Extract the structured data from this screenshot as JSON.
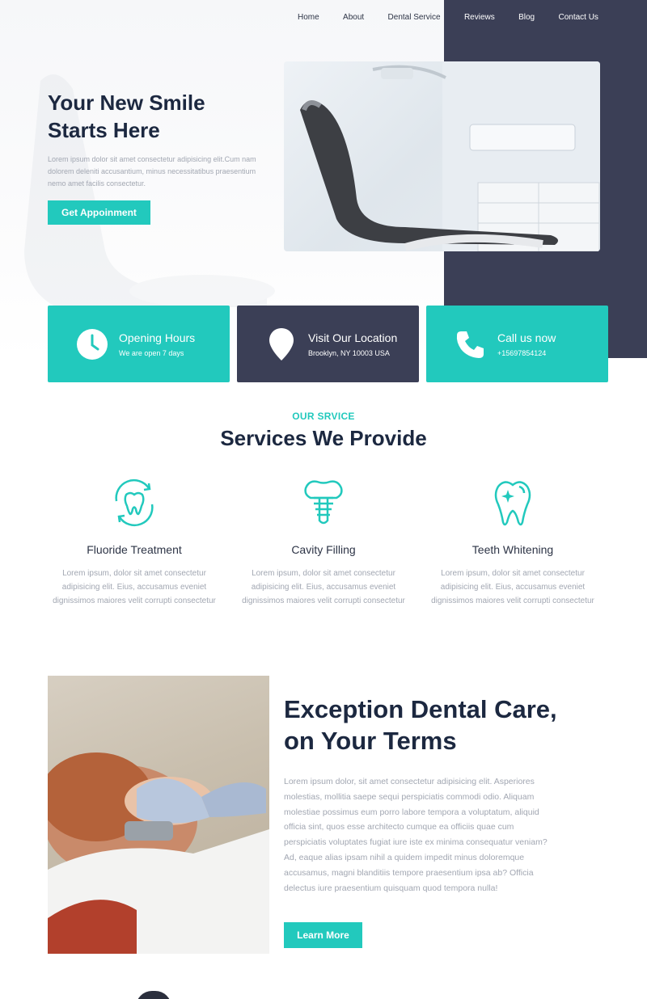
{
  "nav": {
    "items": [
      {
        "label": "Home"
      },
      {
        "label": "About"
      },
      {
        "label": "Dental Service"
      },
      {
        "label": "Reviews"
      },
      {
        "label": "Blog"
      },
      {
        "label": "Contact Us"
      }
    ]
  },
  "hero": {
    "title_line1": "Your New Smile",
    "title_line2": "Starts Here",
    "description": "Lorem ipsum dolor sit amet consectetur adipisicing elit.Cum nam dolorem deleniti accusantium, minus necessitatibus praesentium nemo amet facilis consectetur.",
    "button_label": "Get Appoinment"
  },
  "cards": [
    {
      "title": "Opening Hours",
      "subtitle": "We are open 7 days",
      "icon": "clock-icon"
    },
    {
      "title": "Visit Our Location",
      "subtitle": "Brooklyn, NY 10003 USA",
      "icon": "location-pin-icon"
    },
    {
      "title": "Call us now",
      "subtitle": "+15697854124",
      "icon": "phone-icon"
    }
  ],
  "services": {
    "kicker": "OUR SRVICE",
    "heading": "Services We Provide",
    "items": [
      {
        "title": "Fluoride Treatment",
        "description": "Lorem ipsum, dolor sit amet consectetur adipisicing elit. Eius, accusamus eveniet dignissimos maiores velit corrupti consectetur",
        "icon": "tooth-cycle-icon"
      },
      {
        "title": "Cavity Filling",
        "description": "Lorem ipsum, dolor sit amet consectetur adipisicing elit. Eius, accusamus eveniet dignissimos maiores velit corrupti consectetur",
        "icon": "dental-implant-icon"
      },
      {
        "title": "Teeth Whitening",
        "description": "Lorem ipsum, dolor sit amet consectetur adipisicing elit. Eius, accusamus eveniet dignissimos maiores velit corrupti consectetur",
        "icon": "tooth-sparkle-icon"
      }
    ]
  },
  "care": {
    "title_line1": "Exception Dental Care,",
    "title_line2": "on Your Terms",
    "text": "Lorem ipsum dolor, sit amet consectetur adipisicing elit. Asperiores molestias, mollitia saepe sequi perspiciatis commodi odio. Aliquam molestiae possimus eum porro labore tempora a voluptatum, aliquid officia sint, quos esse architecto cumque ea officiis quae cum perspiciatis voluptates fugiat iure iste ex minima consequatur veniam? Ad, eaque alias ipsam nihil a quidem impedit minus doloremque accusamus, magni blanditiis tempore praesentium ipsa ab? Officia delectus iure praesentium quisquam quod tempora nulla!",
    "button_label": "Learn More"
  },
  "colors": {
    "accent": "#22c9bd",
    "dark": "#3b3f56",
    "heading": "#1c2840",
    "muted": "#a2a7b2"
  }
}
